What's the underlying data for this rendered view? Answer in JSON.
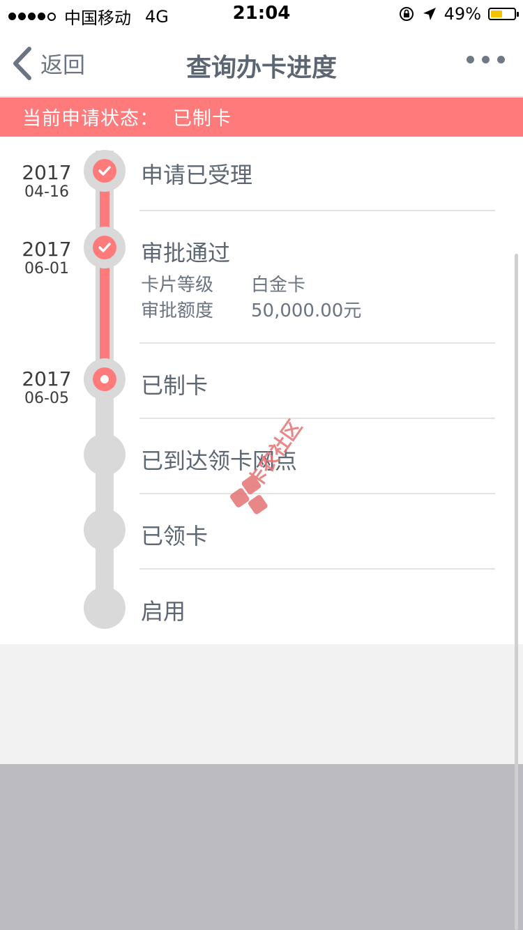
{
  "status_bar": {
    "carrier": "中国移动",
    "network": "4G",
    "time": "21:04",
    "battery_percent": "49%",
    "battery_level": 0.49,
    "battery_color": "#f5c400"
  },
  "nav": {
    "back_label": "返回",
    "title": "查询办卡进度",
    "more_icon": "more-dots-icon"
  },
  "banner": {
    "label": "当前申请状态：",
    "value": "已制卡",
    "color": "#ff7a7a"
  },
  "timeline": [
    {
      "year": "2017",
      "date": "04-16",
      "title": "申请已受理",
      "state": "done"
    },
    {
      "year": "2017",
      "date": "06-01",
      "title": "审批通过",
      "state": "done",
      "details": [
        {
          "key": "卡片等级",
          "value": "白金卡"
        },
        {
          "key": "审批额度",
          "value": "50,000.00元"
        }
      ]
    },
    {
      "year": "2017",
      "date": "06-05",
      "title": "已制卡",
      "state": "current"
    },
    {
      "year": "",
      "date": "",
      "title": "已到达领卡网点",
      "state": "pending"
    },
    {
      "year": "",
      "date": "",
      "title": "已领卡",
      "state": "pending"
    },
    {
      "year": "",
      "date": "",
      "title": "启用",
      "state": "pending"
    }
  ],
  "watermark": {
    "text": "卡农社区"
  },
  "colors": {
    "accent": "#ff7a7a",
    "inactive": "#d9d9d9"
  }
}
